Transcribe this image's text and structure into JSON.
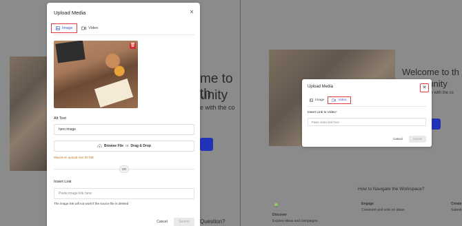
{
  "left": {
    "background": {
      "heading_line1": "me to th",
      "heading_line2": "unity",
      "subtext": "e with the co",
      "bottom_heading": "Question?"
    },
    "modal": {
      "title": "Upload Media",
      "tabs": [
        {
          "label": "Image",
          "icon": "image-icon",
          "active": true
        },
        {
          "label": "Video",
          "icon": "video-icon",
          "active": false
        }
      ],
      "alt_text_label": "Alt Text",
      "alt_text_value": "hero image",
      "browse_label": "Browse File",
      "or_word": "or",
      "drag_label": "Drag & Drop",
      "max_size": "Maximum upload size 50 MB",
      "divider_or": "OR",
      "insert_link_label": "Insert Link",
      "insert_link_placeholder": "Paste image link here",
      "link_warning": "The image link will not work if the source file is deleted",
      "cancel": "Cancel",
      "submit": "Submit"
    }
  },
  "right": {
    "background": {
      "heading_line1": "Welcome to th",
      "heading_line2": "Community",
      "subtext": "ge with the co",
      "navigate_title": "How to Navigate the Workspace?",
      "discover_title": "Discover",
      "discover_text": "Explore ideas and campaigns",
      "engage_title": "Engage",
      "engage_text": "Comment and vote on ideas",
      "create_title": "Create",
      "create_text": "Submit"
    },
    "modal": {
      "title": "Upload Media",
      "tabs": [
        {
          "label": "Image",
          "icon": "image-icon",
          "active": false
        },
        {
          "label": "Video",
          "icon": "video-icon",
          "active": true
        }
      ],
      "video_link_label": "Insert Link to Video",
      "required_mark": "*",
      "video_link_placeholder": "Paste video link here",
      "cancel": "Cancel",
      "submit": "Submit"
    }
  },
  "colors": {
    "accent": "#3b5bcc",
    "highlight": "#e23b3b",
    "warning": "#c07a22",
    "overlay": "#8b8b8b"
  }
}
